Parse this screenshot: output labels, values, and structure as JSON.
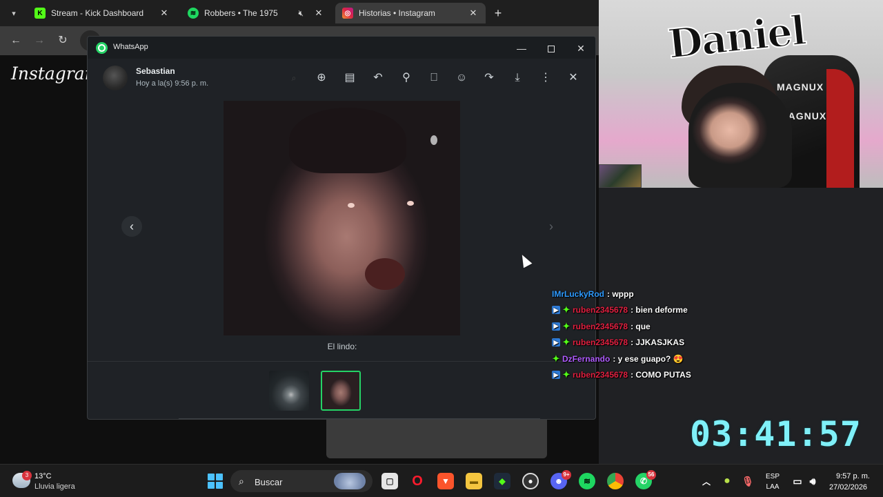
{
  "browser": {
    "tabs": [
      {
        "title": "Stream - Kick Dashboard",
        "favicon": "kick-icon",
        "color": "#53fc18"
      },
      {
        "title": "Robbers • The 1975",
        "favicon": "spotify-icon",
        "color": "#1ed760"
      },
      {
        "title": "Historias • Instagram",
        "favicon": "instagram-icon",
        "color": "#d6249f"
      }
    ],
    "active_tab": 2
  },
  "instagram": {
    "logo_text": "Instagram"
  },
  "whatsapp": {
    "window_title": "WhatsApp",
    "sender": "Sebastian",
    "time": "Hoy a la(s) 9:56 p. m.",
    "caption": "El lindo:",
    "toolbar_icons": [
      "search-icon",
      "zoom-icon",
      "caption-icon",
      "reply-icon",
      "pin-icon",
      "bookmark-icon",
      "emoji-icon",
      "forward-icon",
      "download-icon",
      "more-icon",
      "close-icon"
    ],
    "accent": "#25d366"
  },
  "webcam": {
    "graffiti_text": "Daniel",
    "chair_brand": "MAGNUX"
  },
  "chat": {
    "messages": [
      {
        "user": "IMrLuckyRod",
        "text": ": wppp",
        "color": "#2e9bff",
        "badges": []
      },
      {
        "user": "ruben2345678",
        "text": ": bien deforme",
        "color": "#e02040",
        "badges": [
          "sub-badge",
          "kick-badge"
        ]
      },
      {
        "user": "ruben2345678",
        "text": ": que",
        "color": "#e02040",
        "badges": [
          "sub-badge",
          "kick-badge"
        ]
      },
      {
        "user": "ruben2345678",
        "text": ": JJKASJKAS",
        "color": "#e02040",
        "badges": [
          "sub-badge",
          "kick-badge"
        ]
      },
      {
        "user": "DzFernando",
        "text": ": y ese guapo? 😍",
        "color": "#b05cff",
        "badges": [
          "kick-badge"
        ]
      },
      {
        "user": "ruben2345678",
        "text": ": COMO PUTAS",
        "color": "#e02040",
        "badges": [
          "sub-badge",
          "kick-badge"
        ]
      }
    ]
  },
  "timer": "03:41:57",
  "taskbar": {
    "weather_badge": "3",
    "temperature": "13°C",
    "condition": "Lluvia ligera",
    "search_placeholder": "Buscar",
    "discord_badge": "9+",
    "whatsapp_badge": "56",
    "language": "ESP",
    "layout": "LAA",
    "time": "9:57 p. m.",
    "date": "27/02/2026"
  }
}
